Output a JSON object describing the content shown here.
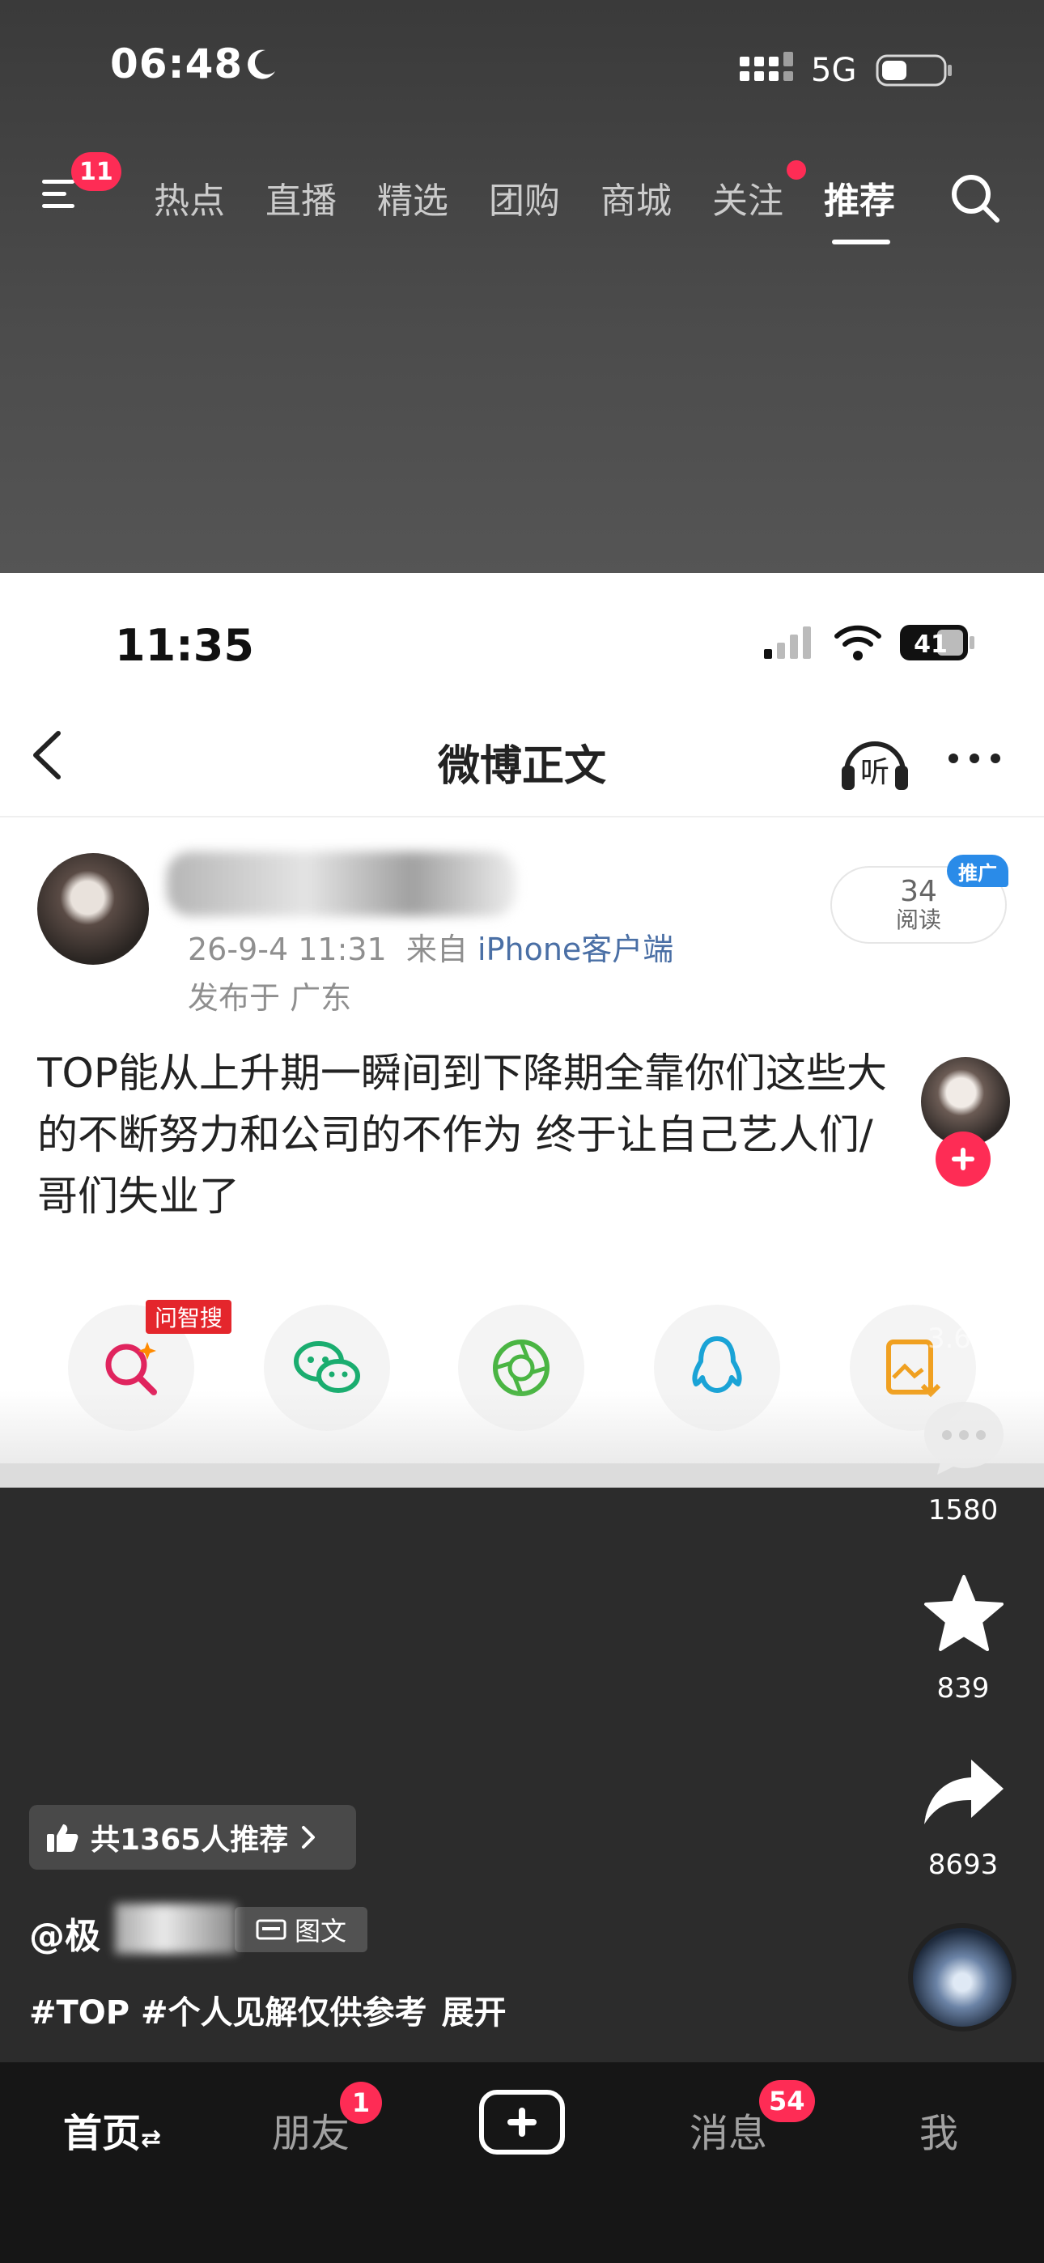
{
  "status_bar": {
    "time": "06:48",
    "network": "5G"
  },
  "top_nav": {
    "menu_badge": "11",
    "tabs": [
      "热点",
      "直播",
      "精选",
      "团购",
      "商城",
      "关注",
      "推荐"
    ],
    "active_tab": "推荐"
  },
  "weibo_screenshot": {
    "status_time": "11:35",
    "battery": "41",
    "title": "微博正文",
    "listen_label": "听",
    "post_meta": "26-9-4 11:31",
    "source_prefix": "来自",
    "source": "iPhone客户端",
    "location": "发布于 广东",
    "read_count": "34",
    "read_label": "阅读",
    "promo_tag": "推广",
    "body_lines": [
      "TOP能从上升期一瞬间到下降期全靠你们这些大",
      "的不断努力和公司的不作为 终于让自己艺人们/",
      "哥们失业了"
    ],
    "ai_search_badge": "问智搜"
  },
  "actions": {
    "like_count": "3.6万",
    "comment_count": "1580",
    "favorite_count": "839",
    "share_count": "8693"
  },
  "post_info": {
    "recommend_text": "共1365人推荐",
    "author": "@极",
    "type_tag": "图文",
    "hashtags": "#TOP #个人见解仅供参考",
    "expand": "展开"
  },
  "tab_bar": {
    "home": "首页",
    "friends": "朋友",
    "friends_badge": "1",
    "messages": "消息",
    "messages_badge": "54",
    "me": "我"
  },
  "colors": {
    "accent": "#fe2c55",
    "weibo_link": "#4a6fa5",
    "promo_blue": "#2a8be8"
  }
}
